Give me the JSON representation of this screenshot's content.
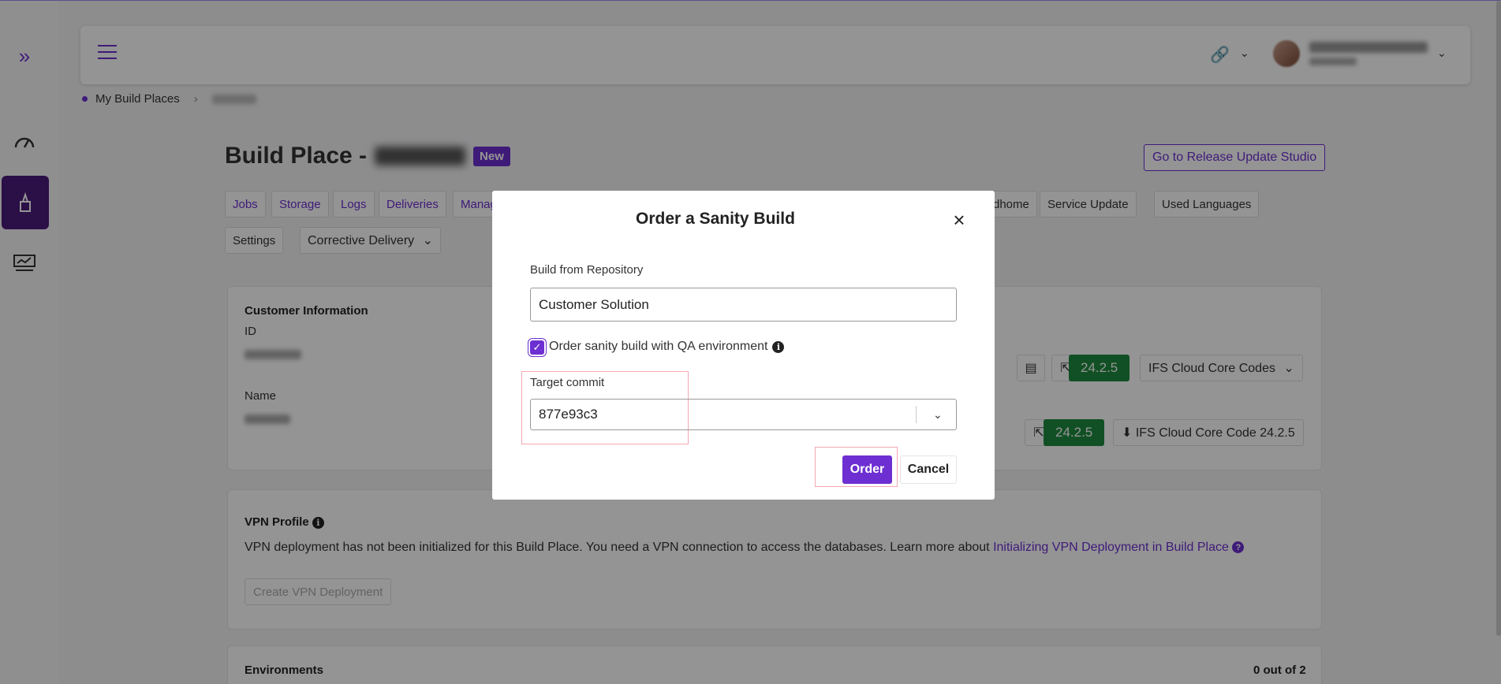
{
  "breadcrumb": {
    "root": "My Build Places"
  },
  "page": {
    "title_prefix": "Build Place -",
    "badge": "New",
    "release_button": "Go to Release Update Studio"
  },
  "tabs": {
    "row1": [
      "Jobs",
      "Storage",
      "Logs",
      "Deliveries",
      "Manag"
    ],
    "row1_right": [
      "dhome",
      "Service Update",
      "Used Languages"
    ],
    "settings": "Settings",
    "corrective": "Corrective Delivery"
  },
  "customer_info": {
    "heading": "Customer Information",
    "id_label": "ID",
    "name_label": "Name",
    "version1": "24.2.5",
    "codes_dropdown": "IFS Cloud Core Codes",
    "version2": "24.2.5",
    "download_label": "IFS Cloud Core Code 24.2.5"
  },
  "vpn": {
    "heading": "VPN Profile",
    "text": "VPN deployment has not been initialized for this Build Place. You need a VPN connection to access the databases. Learn more about",
    "link": "Initializing VPN Deployment in Build Place",
    "button": "Create VPN Deployment"
  },
  "environments": {
    "heading": "Environments",
    "count": "0 out of 2"
  },
  "modal": {
    "title": "Order a Sanity Build",
    "repo_label": "Build from Repository",
    "repo_value": "Customer Solution",
    "checkbox_label": "Order sanity build with QA environment",
    "checkbox_checked": true,
    "commit_label": "Target commit",
    "commit_value": "877e93c3",
    "order_button": "Order",
    "cancel_button": "Cancel"
  },
  "colors": {
    "accent": "#6d2fd1",
    "green": "#1e8a3e",
    "sidebar_active": "#4a1a7a"
  }
}
